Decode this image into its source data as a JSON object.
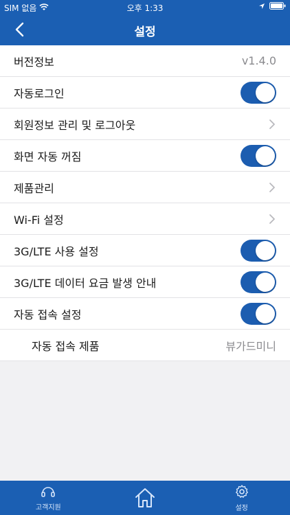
{
  "status": {
    "carrier": "SIM 없음",
    "time": "오후 1:33"
  },
  "header": {
    "title": "설정"
  },
  "settings": [
    {
      "label": "버전정보",
      "type": "value",
      "value": "v1.4.0"
    },
    {
      "label": "자동로그인",
      "type": "toggle",
      "on": true
    },
    {
      "label": "회원정보 관리 및 로그아웃",
      "type": "chevron"
    },
    {
      "label": "화면 자동 꺼짐",
      "type": "toggle",
      "on": true
    },
    {
      "label": "제품관리",
      "type": "chevron"
    },
    {
      "label": "Wi-Fi 설정",
      "type": "chevron"
    },
    {
      "label": "3G/LTE 사용 설정",
      "type": "toggle",
      "on": true
    },
    {
      "label": "3G/LTE 데이터 요금 발생 안내",
      "type": "toggle",
      "on": true
    },
    {
      "label": "자동 접속 설정",
      "type": "toggle",
      "on": true
    },
    {
      "label": "자동 접속 제품",
      "type": "value",
      "value": "뷰가드미니",
      "sub": true
    }
  ],
  "tabs": [
    {
      "label": "고객지원",
      "icon": "headset-icon"
    },
    {
      "label": "",
      "icon": "home-icon"
    },
    {
      "label": "설정",
      "icon": "gear-icon"
    }
  ],
  "colors": {
    "primary": "#1b5fb3",
    "toggle_on": "#1c5db0"
  }
}
